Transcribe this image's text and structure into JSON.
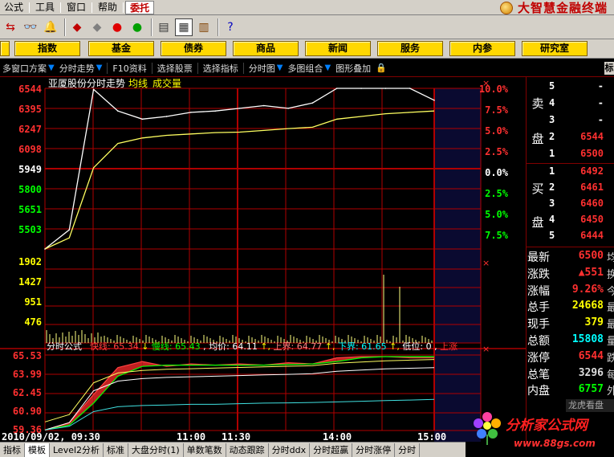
{
  "menubar": {
    "items": [
      "公式",
      "工具",
      "窗口",
      "帮助"
    ],
    "active": "委托",
    "brand": "大智慧金融终端"
  },
  "nav": [
    "指数",
    "基金",
    "债券",
    "商品",
    "新闻",
    "服务",
    "内参",
    "研究室"
  ],
  "strip": {
    "items": [
      "多窗口方案",
      "分时走势",
      "F10资料",
      "选择股票",
      "选择指标",
      "分时图",
      "多图组合",
      "图形叠加"
    ],
    "last": "标"
  },
  "chart": {
    "title": "亚厦股份分时走势",
    "avg_label": "均线",
    "vol_label": "成交量",
    "price_ticks": [
      "6544",
      "6395",
      "6247",
      "6098",
      "5949",
      "5800",
      "5651",
      "5503"
    ],
    "pct_ticks": [
      "10.0%",
      "7.5%",
      "5.0%",
      "2.5%",
      "0.0%",
      "2.5%",
      "5.0%",
      "7.5%"
    ],
    "vol_ticks": [
      "1902",
      "1427",
      "951",
      "476"
    ],
    "ind_ticks": [
      "65.53",
      "63.99",
      "62.45",
      "60.90",
      "59.36"
    ],
    "time_ticks": [
      "2010/09/02, 09:30",
      "11:00",
      "11:30",
      "14:00",
      "15:00"
    ],
    "formula": {
      "name": "分时公式",
      "fast": "快线: 65.34",
      "slow": "慢线: 65.43",
      "avg": "均价: 64.11",
      "upper": "上界: 64.77",
      "lower": "下界: 61.65",
      "low": "低位: 0",
      "up": "上涨"
    },
    "colors": {
      "price": "#ffffff",
      "avg": "#ffff60",
      "up": "#ff3030",
      "down": "#00e000",
      "grid": "#b00000"
    }
  },
  "chart_data": {
    "type": "line",
    "title": "亚厦股份分时走势",
    "xlabel": "",
    "ylabel": "",
    "x": [
      "09:30",
      "09:45",
      "10:00",
      "10:15",
      "10:30",
      "10:45",
      "11:00",
      "11:15",
      "11:30",
      "13:15",
      "13:30",
      "13:45",
      "14:00",
      "14:15",
      "14:30",
      "14:45",
      "15:00"
    ],
    "series": [
      {
        "name": "",
        "values": [
          59.49,
          60.2,
          65.4,
          64.6,
          64.3,
          64.4,
          64.55,
          64.6,
          64.7,
          64.8,
          64.7,
          64.9,
          65.44,
          65.44,
          65.44,
          65.44,
          65.0
        ]
      },
      {
        "name": "均线",
        "values": [
          59.49,
          59.9,
          62.5,
          63.4,
          63.6,
          63.7,
          63.75,
          63.8,
          63.82,
          63.88,
          63.95,
          64.0,
          64.3,
          64.4,
          64.5,
          64.55,
          64.6
        ]
      }
    ],
    "ylim": [
      55.03,
      65.44
    ]
  },
  "orderbook": {
    "sell_label": [
      "卖",
      "盘"
    ],
    "buy_label": [
      "买",
      "盘"
    ],
    "sell": [
      {
        "lvl": "5",
        "price": "-",
        "vol": ""
      },
      {
        "lvl": "4",
        "price": "-",
        "vol": ""
      },
      {
        "lvl": "3",
        "price": "-",
        "vol": ""
      },
      {
        "lvl": "2",
        "price": "6544",
        "vol": ""
      },
      {
        "lvl": "1",
        "price": "6500",
        "vol": ""
      }
    ],
    "buy": [
      {
        "lvl": "1",
        "price": "6492",
        "vol": ""
      },
      {
        "lvl": "2",
        "price": "6461",
        "vol": ""
      },
      {
        "lvl": "3",
        "price": "6460",
        "vol": ""
      },
      {
        "lvl": "4",
        "price": "6450",
        "vol": ""
      },
      {
        "lvl": "5",
        "price": "6444",
        "vol": ""
      }
    ]
  },
  "quote": [
    {
      "k": "最新",
      "v": "6500",
      "c": "#ff3030",
      "t": "均"
    },
    {
      "k": "涨跌",
      "v": "▲551",
      "c": "#ff3030",
      "t": "换"
    },
    {
      "k": "涨幅",
      "v": "9.26%",
      "c": "#ff3030",
      "t": "今"
    },
    {
      "k": "总手",
      "v": "24668",
      "c": "#ffff00",
      "t": "最"
    },
    {
      "k": "现手",
      "v": "379",
      "c": "#ffff00",
      "t": "最"
    },
    {
      "k": "总额",
      "v": "15808",
      "c": "#00ffff",
      "t": "量"
    },
    {
      "k": "涨停",
      "v": "6544",
      "c": "#ff3030",
      "t": "跌"
    },
    {
      "k": "总笔",
      "v": "3296",
      "c": "#dddddd",
      "t": "每"
    },
    {
      "k": "内盘",
      "v": "6757",
      "c": "#00ff00",
      "t": "外"
    }
  ],
  "panel_button": "龙虎看盘",
  "tabs": [
    "指标",
    "模板",
    "Level2分析",
    "标准",
    "大盘分时(1)",
    "单数笔数",
    "动态跟踪",
    "分时ddx",
    "分时超赢",
    "分时涨停",
    "分时"
  ],
  "watermark": {
    "line1": "分析家公式网",
    "line2": "www.88gs.com"
  }
}
